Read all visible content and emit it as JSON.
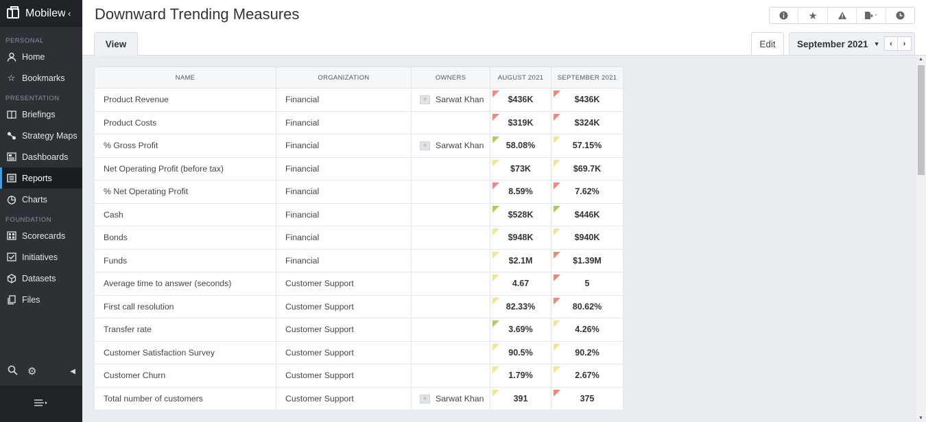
{
  "app": {
    "name": "Mobilew"
  },
  "sidebar": {
    "sections": [
      {
        "label": "PERSONAL"
      },
      {
        "label": "PRESENTATION"
      },
      {
        "label": "FOUNDATION"
      }
    ],
    "items": [
      {
        "label": "Home",
        "icon": "user-icon"
      },
      {
        "label": "Bookmarks",
        "icon": "star-icon"
      },
      {
        "label": "Briefings",
        "icon": "book-icon"
      },
      {
        "label": "Strategy Maps",
        "icon": "map-icon"
      },
      {
        "label": "Dashboards",
        "icon": "dashboard-icon"
      },
      {
        "label": "Reports",
        "icon": "report-icon",
        "active": true
      },
      {
        "label": "Charts",
        "icon": "pie-chart-icon"
      },
      {
        "label": "Scorecards",
        "icon": "scorecard-icon"
      },
      {
        "label": "Initiatives",
        "icon": "checkbox-icon"
      },
      {
        "label": "Datasets",
        "icon": "cube-icon"
      },
      {
        "label": "Files",
        "icon": "files-icon"
      }
    ]
  },
  "header": {
    "title": "Downward Trending Measures"
  },
  "tabs": {
    "view": "View",
    "edit": "Edit"
  },
  "period": {
    "label": "September 2021"
  },
  "colors": {
    "red": "#ef8a76",
    "yellow": "#f8e48c",
    "green": "#a9d15a",
    "accent": "#3aa0e6"
  },
  "table": {
    "headers": [
      "NAME",
      "ORGANIZATION",
      "OWNERS",
      "AUGUST 2021",
      "SEPTEMBER 2021"
    ],
    "rows": [
      {
        "name": "Product Revenue",
        "org": "Financial",
        "owner": "Sarwat Khan",
        "aug": "$436K",
        "aug_status": "red",
        "sep": "$436K",
        "sep_status": "red"
      },
      {
        "name": "Product Costs",
        "org": "Financial",
        "owner": "",
        "aug": "$319K",
        "aug_status": "red",
        "sep": "$324K",
        "sep_status": "red"
      },
      {
        "name": "% Gross Profit",
        "org": "Financial",
        "owner": "Sarwat Khan",
        "aug": "58.08%",
        "aug_status": "green",
        "sep": "57.15%",
        "sep_status": "yellow"
      },
      {
        "name": "Net Operating Profit (before tax)",
        "org": "Financial",
        "owner": "",
        "aug": "$73K",
        "aug_status": "yellow",
        "sep": "$69.7K",
        "sep_status": "yellow"
      },
      {
        "name": "% Net Operating Profit",
        "org": "Financial",
        "owner": "",
        "aug": "8.59%",
        "aug_status": "red",
        "sep": "7.62%",
        "sep_status": "red"
      },
      {
        "name": "Cash",
        "org": "Financial",
        "owner": "",
        "aug": "$528K",
        "aug_status": "green",
        "sep": "$446K",
        "sep_status": "green"
      },
      {
        "name": "Bonds",
        "org": "Financial",
        "owner": "",
        "aug": "$948K",
        "aug_status": "yellow",
        "sep": "$940K",
        "sep_status": "yellow"
      },
      {
        "name": "Funds",
        "org": "Financial",
        "owner": "",
        "aug": "$2.1M",
        "aug_status": "yellow",
        "sep": "$1.39M",
        "sep_status": "red"
      },
      {
        "name": "Average time to answer (seconds)",
        "org": "Customer Support",
        "owner": "",
        "aug": "4.67",
        "aug_status": "yellow",
        "sep": "5",
        "sep_status": "red"
      },
      {
        "name": "First call resolution",
        "org": "Customer Support",
        "owner": "",
        "aug": "82.33%",
        "aug_status": "yellow",
        "sep": "80.62%",
        "sep_status": "red"
      },
      {
        "name": "Transfer rate",
        "org": "Customer Support",
        "owner": "",
        "aug": "3.69%",
        "aug_status": "green",
        "sep": "4.26%",
        "sep_status": "yellow"
      },
      {
        "name": "Customer Satisfaction Survey",
        "org": "Customer Support",
        "owner": "",
        "aug": "90.5%",
        "aug_status": "yellow",
        "sep": "90.2%",
        "sep_status": "yellow"
      },
      {
        "name": "Customer Churn",
        "org": "Customer Support",
        "owner": "",
        "aug": "1.79%",
        "aug_status": "yellow",
        "sep": "2.67%",
        "sep_status": "yellow"
      },
      {
        "name": "Total number of customers",
        "org": "Customer Support",
        "owner": "Sarwat Khan",
        "aug": "391",
        "aug_status": "yellow",
        "sep": "375",
        "sep_status": "red"
      }
    ]
  }
}
